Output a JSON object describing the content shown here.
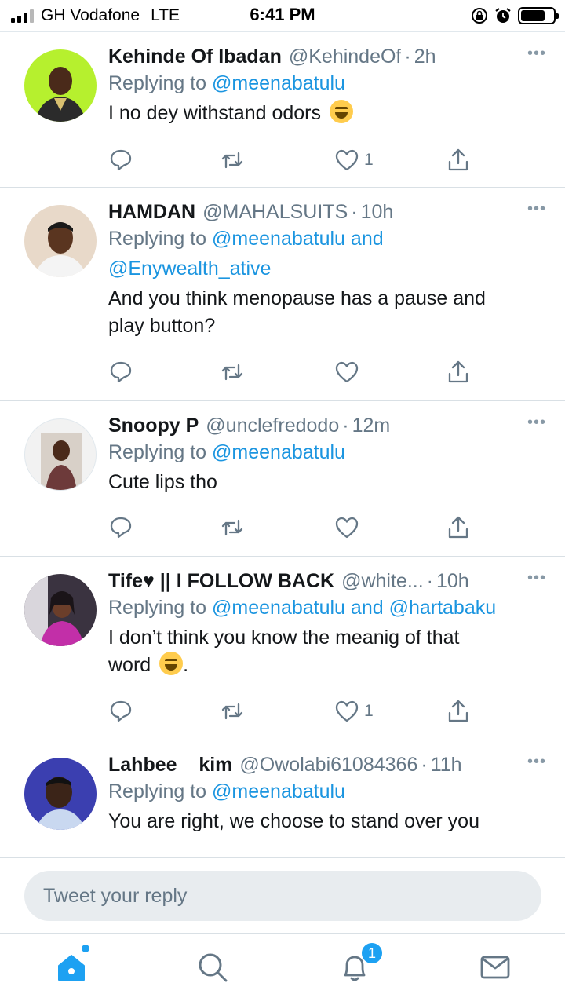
{
  "status_bar": {
    "carrier": "GH Vodafone",
    "network": "LTE",
    "time": "6:41 PM",
    "battery_level": 0.75
  },
  "tweets": [
    {
      "name": "Kehinde Of Ibadan",
      "handle": "@KehindeOf",
      "time": "2h",
      "replying_prefix": "Replying to ",
      "replying_to": "@meenabatulu",
      "text": "I no dey withstand odors",
      "emoji": "rolling-on-floor-laughing-emoji",
      "likes": "1",
      "avatar_color": "#b6f02e"
    },
    {
      "name": "HAMDAN",
      "handle": "@MAHALSUITS",
      "time": "10h",
      "replying_prefix": "Replying to ",
      "replying_to": "@meenabatulu and",
      "replying_to_2": "@Enywealth_ative",
      "text_line1": "And you think menopause has a pause and",
      "text_line2": "play button?",
      "likes": "",
      "avatar_color": "#e8d9c9"
    },
    {
      "name": "Snoopy P",
      "handle": "@unclefredodo",
      "time": "12m",
      "replying_prefix": "Replying to ",
      "replying_to": "@meenabatulu",
      "text": "Cute lips tho",
      "likes": "",
      "avatar_color": "#f2f2f2"
    },
    {
      "name": "Tife♥ || I FOLLOW BACK",
      "handle": "@white...",
      "time": "10h",
      "replying_prefix": "Replying to ",
      "replying_to": "@meenabatulu and @hartabaku",
      "text_line1": "I don’t think you know the meanig of that",
      "text_line2": "word",
      "text_line2_suffix": ".",
      "emoji": "face-with-tears-of-joy-emoji",
      "likes": "1",
      "avatar_color": "#3a3340"
    },
    {
      "name": "Lahbee__kim",
      "handle": "@Owolabi61084366",
      "time": "11h",
      "replying_prefix": "Replying to ",
      "replying_to": "@meenabatulu",
      "text": "You are right, we choose to stand over you",
      "likes": "",
      "avatar_color": "#3b3fb0"
    }
  ],
  "more_glyph": "•••",
  "dot_sep": "·",
  "reply_box": {
    "placeholder": "Tweet your reply"
  },
  "tab_bar": {
    "notifications_badge": "1",
    "accent": "#1da1f2"
  }
}
